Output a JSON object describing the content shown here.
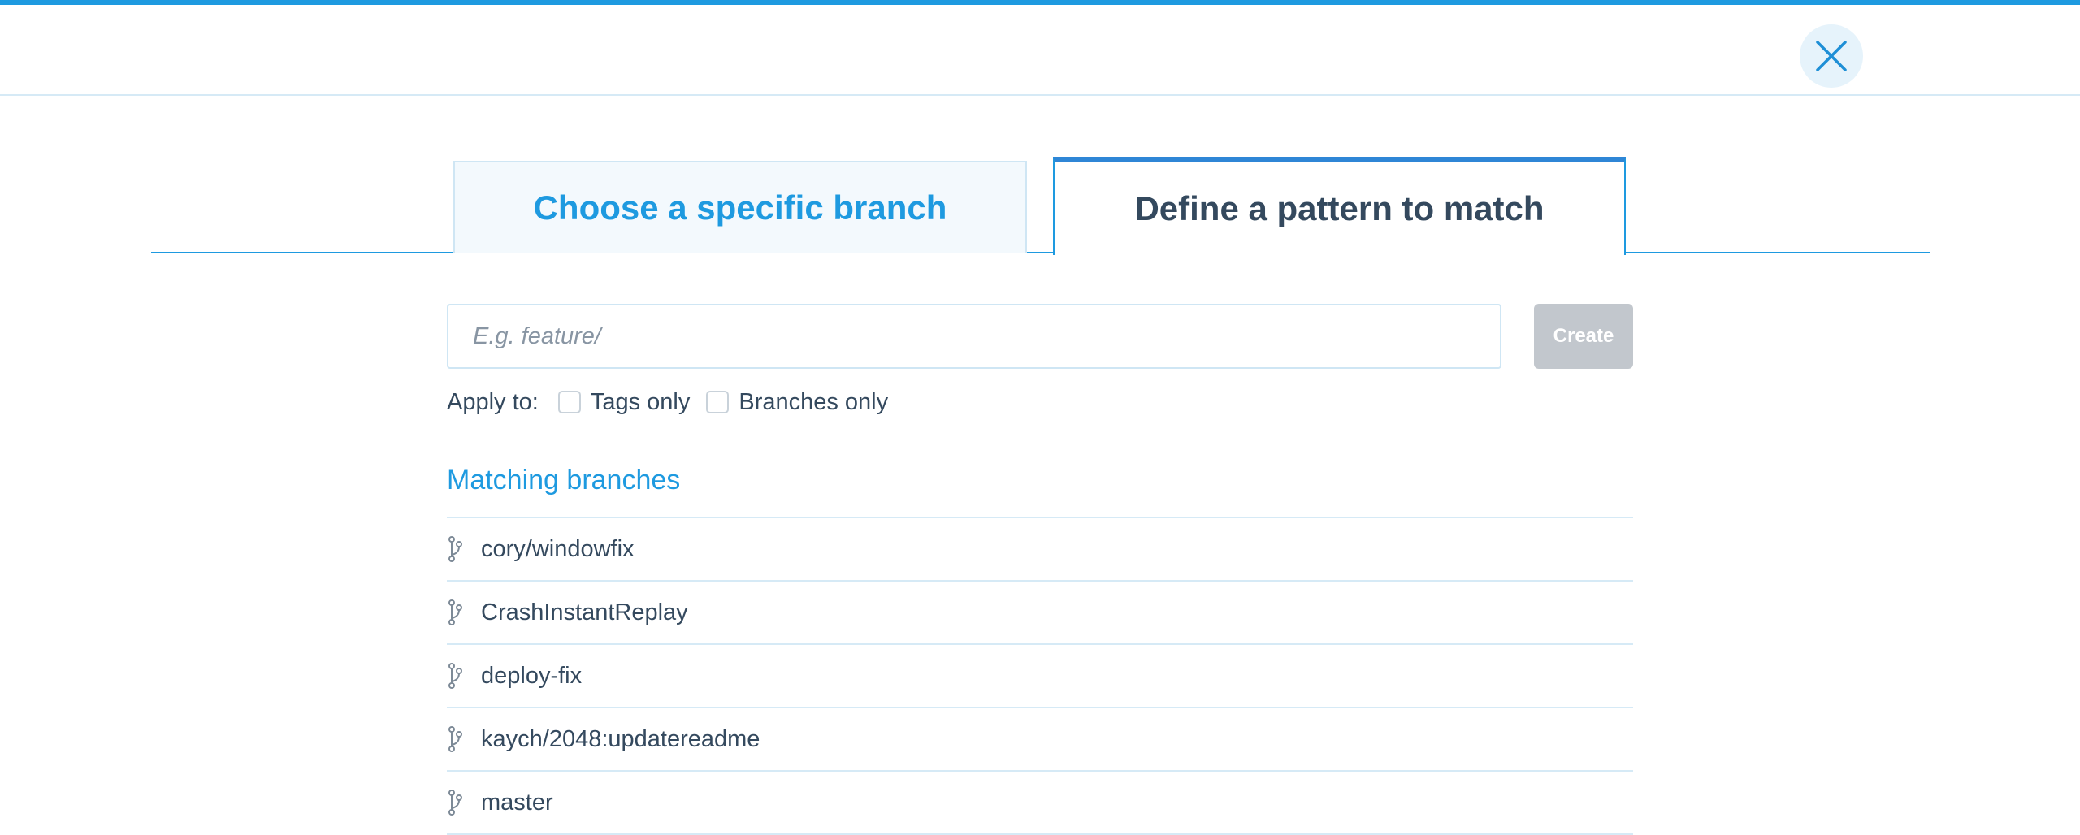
{
  "header": {
    "close_icon": "close-icon"
  },
  "tabs": [
    {
      "label": "Choose a specific branch",
      "active": false
    },
    {
      "label": "Define a pattern to match",
      "active": true
    }
  ],
  "pattern_form": {
    "input_placeholder": "E.g. feature/",
    "input_value": "",
    "create_label": "Create",
    "apply_to_label": "Apply to:",
    "tags_only_label": "Tags only",
    "branches_only_label": "Branches only"
  },
  "matching": {
    "title": "Matching branches",
    "branch_icon": "branch-icon",
    "branches": [
      "cory/windowfix",
      "CrashInstantReplay",
      "deploy-fix",
      "kaych/2048:updatereadme",
      "master"
    ]
  },
  "colors": {
    "accent": "#1e9ae0",
    "text": "#34495e",
    "disabled_button": "#c2c7cd"
  }
}
